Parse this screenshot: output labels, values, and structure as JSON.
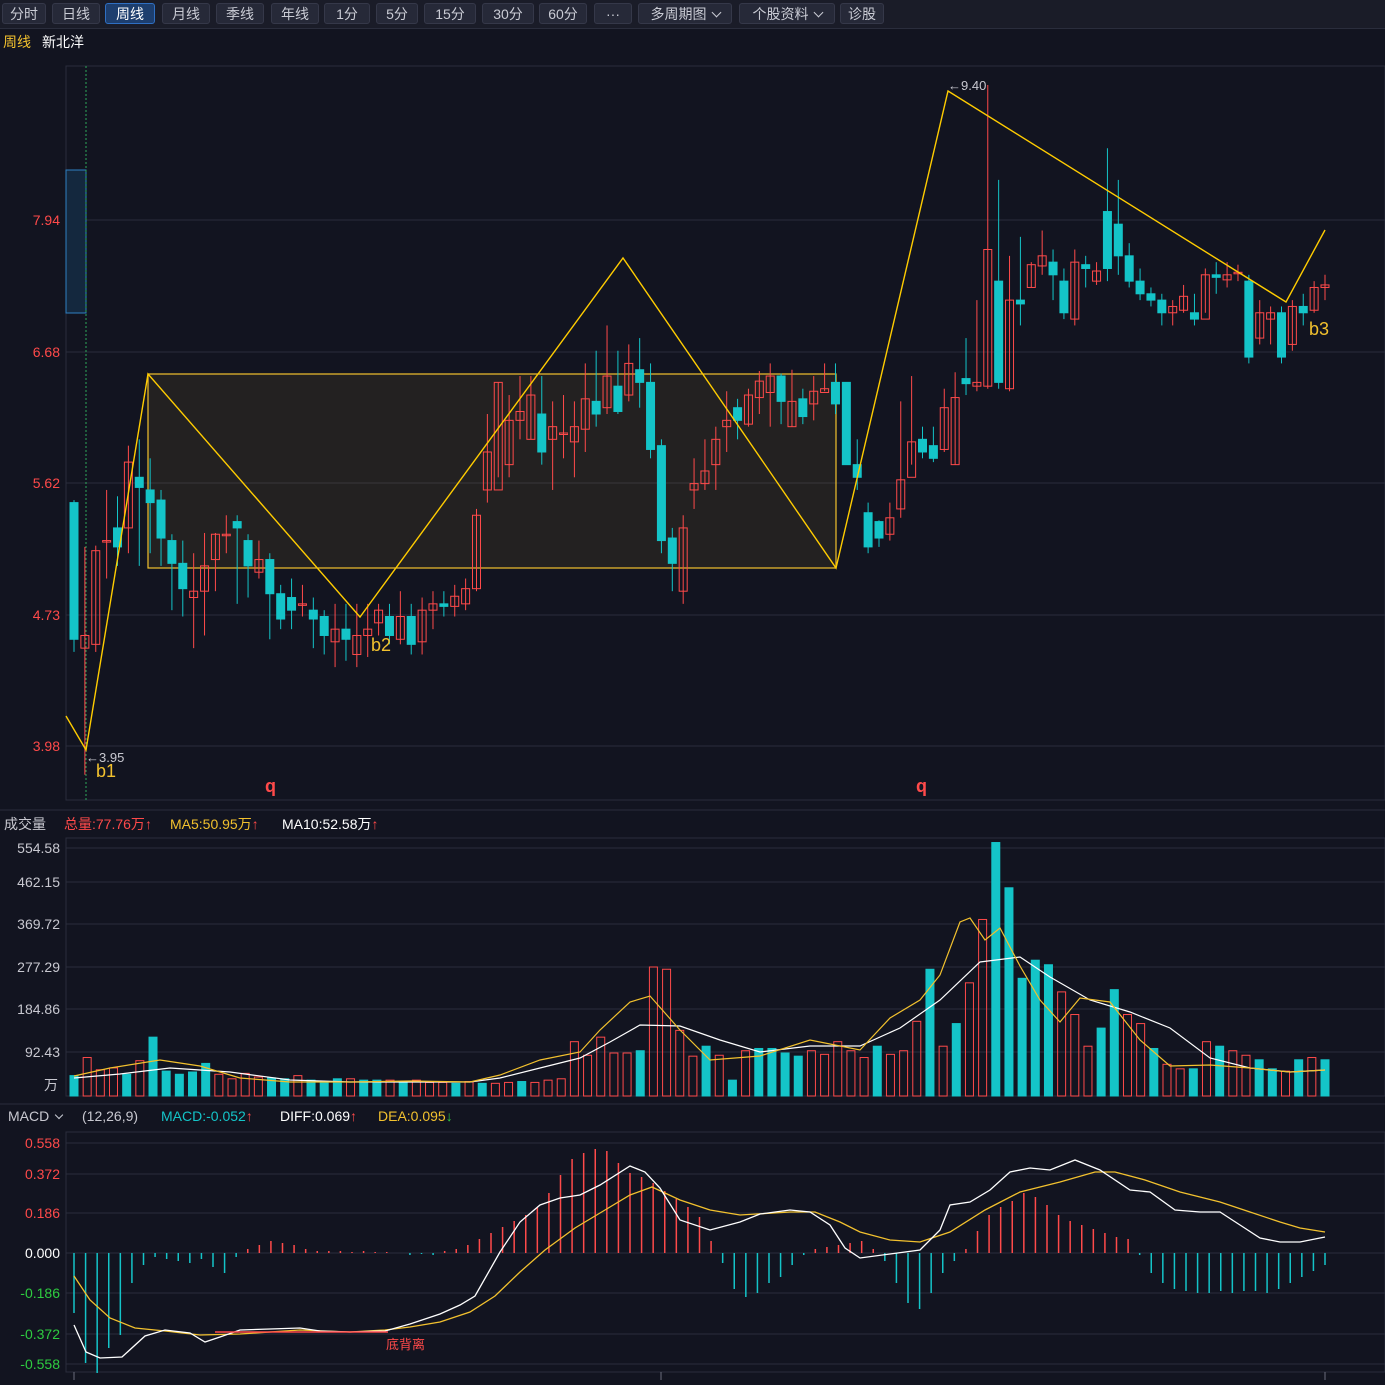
{
  "toolbar": {
    "tabs": [
      {
        "label": "分时",
        "active": false
      },
      {
        "label": "日线",
        "active": false
      },
      {
        "label": "周线",
        "active": true
      },
      {
        "label": "月线",
        "active": false
      },
      {
        "label": "季线",
        "active": false
      },
      {
        "label": "年线",
        "active": false
      },
      {
        "label": "1分",
        "active": false
      },
      {
        "label": "5分",
        "active": false
      },
      {
        "label": "15分",
        "active": false
      },
      {
        "label": "30分",
        "active": false
      },
      {
        "label": "60分",
        "active": false
      },
      {
        "label": "···",
        "active": false
      },
      {
        "label": "多周期图",
        "active": false,
        "dropdown": true
      },
      {
        "label": "个股资料",
        "active": false,
        "dropdown": true
      },
      {
        "label": "诊股",
        "active": false
      }
    ]
  },
  "header": {
    "period": "周线",
    "stock_name": "新北洋"
  },
  "price_panel": {
    "y_ticks": [
      "7.94",
      "6.68",
      "5.62",
      "4.73",
      "3.98"
    ],
    "high_label": "←9.40",
    "low_label": "←3.95",
    "markers": [
      "b1",
      "b2",
      "b3"
    ],
    "q_labels": [
      "q",
      "q"
    ]
  },
  "volume_panel": {
    "title": "成交量",
    "total": "总量:77.76万",
    "ma5": "MA5:50.95万",
    "ma10": "MA10:52.58万",
    "y_ticks": [
      "554.58",
      "462.15",
      "369.72",
      "277.29",
      "184.86",
      "92.43"
    ],
    "unit": "万"
  },
  "macd_panel": {
    "title": "MACD",
    "params": "(12,26,9)",
    "macd": "MACD:-0.052",
    "diff": "DIFF:0.069",
    "dea": "DEA:0.095",
    "y_ticks": [
      "0.558",
      "0.372",
      "0.186",
      "0.000",
      "-0.186",
      "-0.372",
      "-0.558"
    ],
    "divergence_label": "底背离"
  },
  "colors": {
    "up": "#ff4a4a",
    "down": "#14c4c8",
    "zigzag": "#ffcc00",
    "ma_yellow": "#f2c12e",
    "ma_white": "#ffffff",
    "background": "#121420"
  },
  "chart_data": {
    "type": "candlestick",
    "timeframe": "weekly",
    "price_range": [
      3.75,
      9.55
    ],
    "candles": [
      [
        6.1,
        5.02,
        6.12,
        4.92
      ],
      [
        4.95,
        5.05,
        5.75,
        3.95
      ],
      [
        4.98,
        5.72,
        5.76,
        4.92
      ],
      [
        5.8,
        5.8,
        6.2,
        5.5
      ],
      [
        5.9,
        5.75,
        6.15,
        5.6
      ],
      [
        5.9,
        6.42,
        6.55,
        5.7
      ],
      [
        6.3,
        6.22,
        6.6,
        5.6
      ],
      [
        6.2,
        6.1,
        6.45,
        5.7
      ],
      [
        6.12,
        5.82,
        6.2,
        5.6
      ],
      [
        5.8,
        5.62,
        5.85,
        5.25
      ],
      [
        5.62,
        5.42,
        5.8,
        5.2
      ],
      [
        5.35,
        5.4,
        5.7,
        4.95
      ],
      [
        5.4,
        5.6,
        5.86,
        5.05
      ],
      [
        5.65,
        5.85,
        5.86,
        5.4
      ],
      [
        5.85,
        5.85,
        6.0,
        5.7
      ],
      [
        5.95,
        5.9,
        6.0,
        5.3
      ],
      [
        5.8,
        5.6,
        5.85,
        5.35
      ],
      [
        5.55,
        5.65,
        5.8,
        5.5
      ],
      [
        5.65,
        5.38,
        5.7,
        5.02
      ],
      [
        5.38,
        5.18,
        5.45,
        5.1
      ],
      [
        5.35,
        5.25,
        5.5,
        5.1
      ],
      [
        5.3,
        5.3,
        5.45,
        5.2
      ],
      [
        5.25,
        5.18,
        5.35,
        4.95
      ],
      [
        5.2,
        5.05,
        5.25,
        4.9
      ],
      [
        5.0,
        5.1,
        5.3,
        4.8
      ],
      [
        5.1,
        5.02,
        5.3,
        4.85
      ],
      [
        4.9,
        5.05,
        5.3,
        4.8
      ],
      [
        5.05,
        5.1,
        5.3,
        4.88
      ],
      [
        5.15,
        5.25,
        5.3,
        5.05
      ],
      [
        5.2,
        5.05,
        5.3,
        4.98
      ],
      [
        5.02,
        5.2,
        5.4,
        4.98
      ],
      [
        5.2,
        4.98,
        5.3,
        4.9
      ],
      [
        5.0,
        5.25,
        5.35,
        4.9
      ],
      [
        5.25,
        5.3,
        5.4,
        5.1
      ],
      [
        5.3,
        5.28,
        5.4,
        5.2
      ],
      [
        5.28,
        5.36,
        5.45,
        5.2
      ],
      [
        5.3,
        5.42,
        5.5,
        5.25
      ],
      [
        5.42,
        6.0,
        6.05,
        5.4
      ],
      [
        6.2,
        6.5,
        6.8,
        6.1
      ],
      [
        6.2,
        7.05,
        7.05,
        6.3
      ],
      [
        6.4,
        6.75,
        6.95,
        6.3
      ],
      [
        6.75,
        6.82,
        7.1,
        6.6
      ],
      [
        6.6,
        6.95,
        7.1,
        6.6
      ],
      [
        6.8,
        6.5,
        7.1,
        6.4
      ],
      [
        6.6,
        6.7,
        6.9,
        6.2
      ],
      [
        6.65,
        6.65,
        6.95,
        6.45
      ],
      [
        6.58,
        6.7,
        6.9,
        6.3
      ],
      [
        6.68,
        6.92,
        7.2,
        6.5
      ],
      [
        6.9,
        6.8,
        7.3,
        6.7
      ],
      [
        6.85,
        7.1,
        7.5,
        6.8
      ],
      [
        7.02,
        6.82,
        7.3,
        6.8
      ],
      [
        6.95,
        7.2,
        7.35,
        6.9
      ],
      [
        7.15,
        7.05,
        7.4,
        6.85
      ],
      [
        7.05,
        6.52,
        7.2,
        6.45
      ],
      [
        6.55,
        5.8,
        6.6,
        5.7
      ],
      [
        5.82,
        5.62,
        5.9,
        5.4
      ],
      [
        5.4,
        5.9,
        6.0,
        5.3
      ],
      [
        6.2,
        6.25,
        6.45,
        6.05
      ],
      [
        6.25,
        6.35,
        6.6,
        6.2
      ],
      [
        6.4,
        6.6,
        6.7,
        6.2
      ],
      [
        6.7,
        6.75,
        6.98,
        6.5
      ],
      [
        6.85,
        6.75,
        6.92,
        6.6
      ],
      [
        6.72,
        6.95,
        7.0,
        6.7
      ],
      [
        6.93,
        7.06,
        7.14,
        6.8
      ],
      [
        6.97,
        7.1,
        7.2,
        6.7
      ],
      [
        7.1,
        6.9,
        7.12,
        6.72
      ],
      [
        6.7,
        6.9,
        7.15,
        6.7
      ],
      [
        6.92,
        6.78,
        7.0,
        6.72
      ],
      [
        6.88,
        6.98,
        7.1,
        6.75
      ],
      [
        6.97,
        7.0,
        7.2,
        6.98
      ],
      [
        7.05,
        6.88,
        7.2,
        6.8
      ],
      [
        7.05,
        6.4,
        7.05,
        6.45
      ],
      [
        6.4,
        6.3,
        6.6,
        6.2
      ],
      [
        6.02,
        5.75,
        6.1,
        5.7
      ],
      [
        5.95,
        5.82,
        5.96,
        5.75
      ],
      [
        5.85,
        5.98,
        6.1,
        5.8
      ],
      [
        6.05,
        6.28,
        6.9,
        5.98
      ],
      [
        6.3,
        6.58,
        7.1,
        6.4
      ],
      [
        6.6,
        6.5,
        6.7,
        6.45
      ],
      [
        6.55,
        6.45,
        6.7,
        6.42
      ],
      [
        6.52,
        6.85,
        7.0,
        6.5
      ],
      [
        6.4,
        6.93,
        7.13,
        6.4
      ],
      [
        7.08,
        7.04,
        7.4,
        6.95
      ],
      [
        7.02,
        7.05,
        7.7,
        6.98
      ],
      [
        7.02,
        8.1,
        9.4,
        7.0
      ],
      [
        7.85,
        7.05,
        8.65,
        7.0
      ],
      [
        7.0,
        7.7,
        8.05,
        6.98
      ],
      [
        7.7,
        7.67,
        8.2,
        7.5
      ],
      [
        7.8,
        7.98,
        8.0,
        7.8
      ],
      [
        7.97,
        8.05,
        8.25,
        7.9
      ],
      [
        8.0,
        7.9,
        8.1,
        7.7
      ],
      [
        7.85,
        7.6,
        7.95,
        7.55
      ],
      [
        7.55,
        8.0,
        8.1,
        7.5
      ],
      [
        7.98,
        7.95,
        8.05,
        7.8
      ],
      [
        7.85,
        7.93,
        8.0,
        7.82
      ],
      [
        8.4,
        7.95,
        8.9,
        7.85
      ],
      [
        8.3,
        8.05,
        8.65,
        7.9
      ],
      [
        8.05,
        7.85,
        8.15,
        7.8
      ],
      [
        7.85,
        7.75,
        7.95,
        7.7
      ],
      [
        7.75,
        7.7,
        7.8,
        7.65
      ],
      [
        7.7,
        7.6,
        7.75,
        7.5
      ],
      [
        7.6,
        7.65,
        7.7,
        7.5
      ],
      [
        7.62,
        7.73,
        7.82,
        7.6
      ],
      [
        7.6,
        7.55,
        7.75,
        7.5
      ],
      [
        7.55,
        7.9,
        7.95,
        7.6
      ],
      [
        7.9,
        7.88,
        8.0,
        7.75
      ],
      [
        7.86,
        7.9,
        8.0,
        7.8
      ],
      [
        7.92,
        7.92,
        7.98,
        7.85
      ],
      [
        7.85,
        7.25,
        7.9,
        7.2
      ],
      [
        7.4,
        7.6,
        7.7,
        7.35
      ],
      [
        7.55,
        7.6,
        7.65,
        7.35
      ],
      [
        7.6,
        7.25,
        7.65,
        7.2
      ],
      [
        7.35,
        7.65,
        7.7,
        7.3
      ],
      [
        7.65,
        7.6,
        7.75,
        7.5
      ],
      [
        7.62,
        7.8,
        7.85,
        7.6
      ],
      [
        7.8,
        7.82,
        7.9,
        7.7
      ]
    ],
    "volume_range": [
      0,
      570
    ],
    "volume": [
      45,
      85,
      58,
      62,
      48,
      78,
      130,
      55,
      48,
      53,
      72,
      48,
      38,
      50,
      42,
      40,
      38,
      45,
      35,
      32,
      38,
      38,
      35,
      35,
      35,
      32,
      35,
      30,
      30,
      28,
      32,
      28,
      28,
      30,
      32,
      30,
      35,
      38,
      120,
      90,
      130,
      95,
      95,
      100,
      285,
      280,
      145,
      88,
      110,
      90,
      35,
      100,
      105,
      105,
      95,
      88,
      100,
      92,
      120,
      100,
      85,
      110,
      92,
      100,
      165,
      280,
      110,
      160,
      250,
      390,
      560,
      460,
      260,
      300,
      290,
      230,
      180,
      110,
      150,
      235,
      180,
      160,
      105,
      70,
      60,
      60,
      120,
      110,
      100,
      90,
      80,
      60,
      55,
      80,
      85,
      80
    ]
  }
}
